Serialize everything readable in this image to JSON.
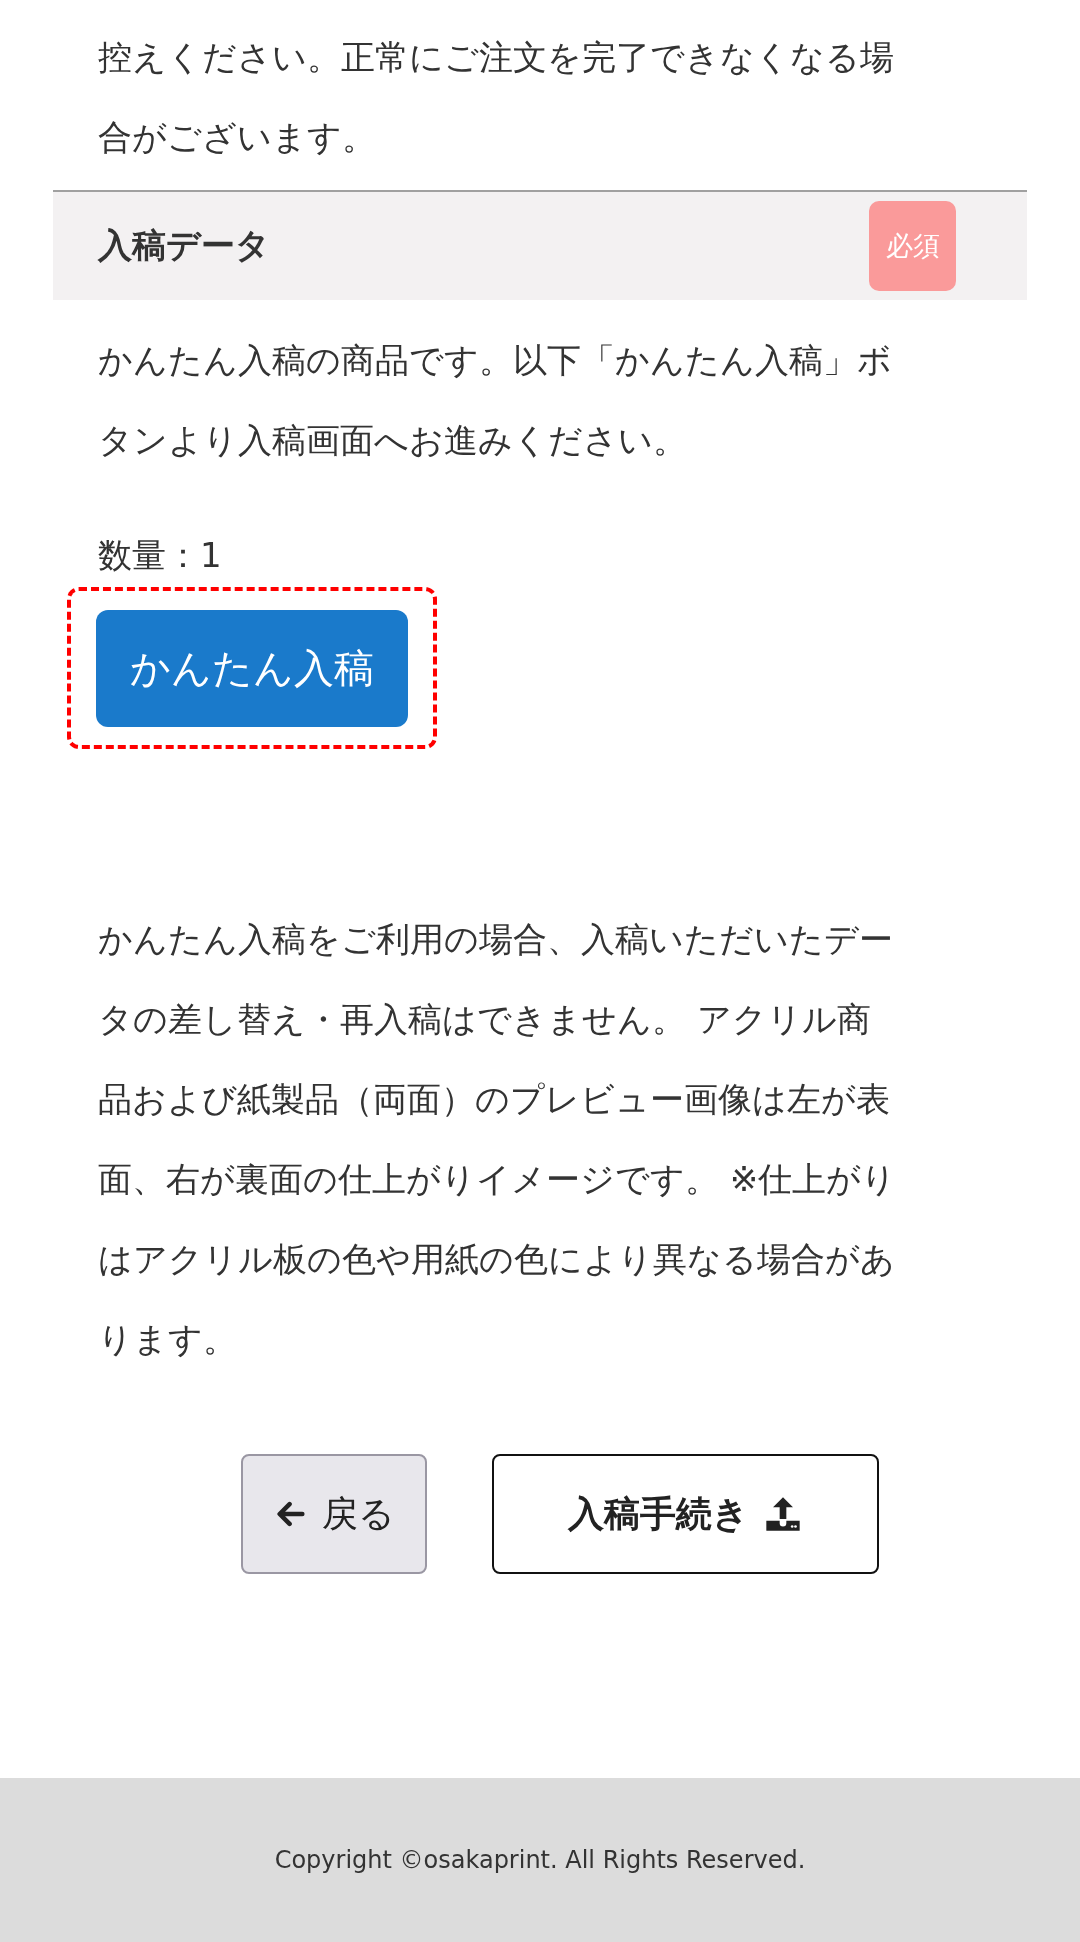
{
  "intro_text": "控えください。正常にご注文を完了できなくなる場合がございます。",
  "section": {
    "title": "入稿データ",
    "badge": "必須"
  },
  "description": "かんたん入稿の商品です。以下「かんたん入稿」ボタンより入稿画面へお進みください。",
  "quantity": "数量：1",
  "upload_button": {
    "label": "かんたん入稿",
    "highlighted": true
  },
  "note": "かんたん入稿をご利用の場合、入稿いただいたデータの差し替え・再入稿はできません。 アクリル商品および紙製品（両面）のプレビュー画像は左が表面、右が裏面の仕上がりイメージです。 ※仕上がりはアクリル板の色や用紙の色により異なる場合があります。",
  "buttons": [
    {
      "kind": "back",
      "label": "戻る"
    },
    {
      "kind": "submit",
      "label": "入稿手続き"
    }
  ],
  "footer": "Copyright ©osakaprint. All Rights Reserved."
}
